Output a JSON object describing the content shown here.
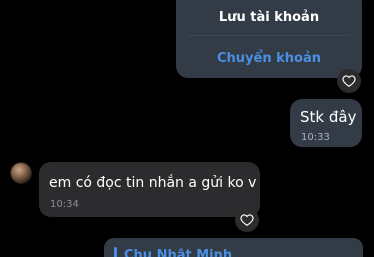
{
  "top_card": {
    "save_label": "Lưu tài khoản",
    "transfer_label": "Chuyển khoản"
  },
  "messages": [
    {
      "direction": "outgoing",
      "text": "Stk đây",
      "time": "10:33"
    },
    {
      "direction": "incoming",
      "text": "em có đọc tin nhắn a gửi ko v",
      "time": "10:34"
    }
  ],
  "quoted_card": {
    "sender_name": "Chu Nhật Minh"
  },
  "icons": {
    "reaction": "heart-icon",
    "avatar": "avatar"
  },
  "colors": {
    "background": "#000000",
    "outgoing_bubble": "#333b47",
    "incoming_bubble": "#2c2c2e",
    "accent": "#4a90e2"
  }
}
